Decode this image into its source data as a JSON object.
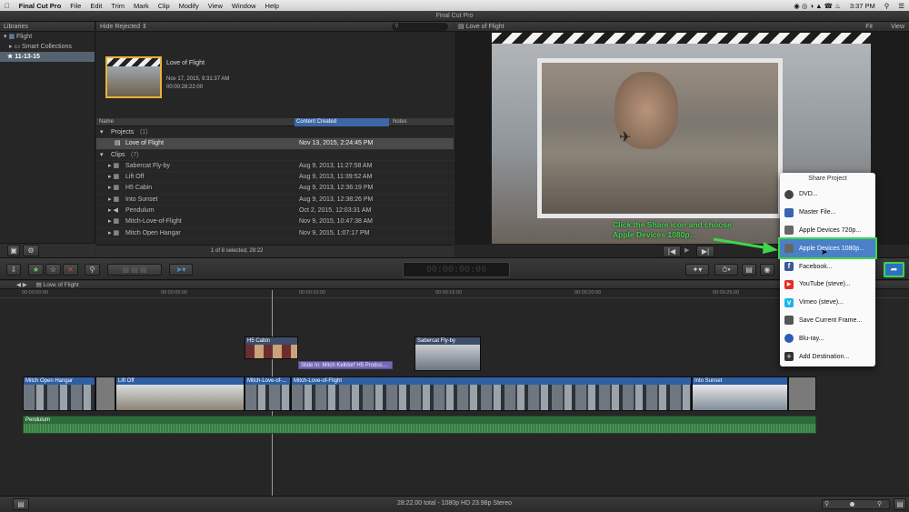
{
  "menubar": {
    "items": [
      "Final Cut Pro",
      "File",
      "Edit",
      "Trim",
      "Mark",
      "Clip",
      "Modify",
      "View",
      "Window",
      "Help"
    ],
    "time": "3:37 PM"
  },
  "window": {
    "title": "Final Cut Pro"
  },
  "libraries": {
    "header": "Libraries",
    "items": [
      "Flight",
      "Smart Collections",
      "11-13-15"
    ]
  },
  "browser": {
    "filter": "Hide Rejected",
    "featured": {
      "title": "Love of Flight",
      "date": "Nov 17, 2015, 9:31:37 AM",
      "duration": "00:00:28:22:00"
    },
    "columns": [
      "Name",
      "Content Created",
      "Notes"
    ],
    "groups": [
      {
        "label": "Projects",
        "count": "(1)",
        "rows": [
          {
            "name": "Love of Flight",
            "date": "Nov 13, 2015, 2:24:45 PM"
          }
        ]
      },
      {
        "label": "Clips",
        "count": "(7)",
        "rows": [
          {
            "name": "Sabercat Fly-by",
            "date": "Aug 9, 2013, 11:27:58 AM"
          },
          {
            "name": "Lift Off",
            "date": "Aug 9, 2013, 11:39:52 AM"
          },
          {
            "name": "H5 Cabin",
            "date": "Aug 9, 2013, 12:36:19 PM"
          },
          {
            "name": "Into Sunset",
            "date": "Aug 9, 2013, 12:38:26 PM"
          },
          {
            "name": "Pendulum",
            "date": "Oct 2, 2015, 12:03:31 AM"
          },
          {
            "name": "Mitch-Love-of-Flight",
            "date": "Nov 9, 2015, 10:47:38 AM"
          },
          {
            "name": "Mitch Open Hangar",
            "date": "Nov 9, 2015, 1:07:17 PM"
          }
        ]
      }
    ],
    "footer": "1 of 8 selected, 28:22"
  },
  "viewer": {
    "title": "Love of Flight",
    "fit": "Fit",
    "view": "View"
  },
  "annotation": {
    "line1": "Click the Share icon and choose",
    "line2": "Apple Devices 1080p..."
  },
  "timecode": "00:00:00:00",
  "timeline": {
    "project": "Love of Flight",
    "ruler": [
      "00:00:00:00",
      "00:00:05:00",
      "00:00:10:00",
      "00:00:15:00",
      "00:00:20:00",
      "00:00:25:00"
    ],
    "clips": {
      "h5": "H5 Cabin",
      "sabercat": "Sabercat Fly-by",
      "title": "Slide In: Mitch Kelldorf H5 Produc...",
      "hangar": "Mitch Open Hangar",
      "lift": "Lift Off",
      "mitch1": "Mitch-Love-of-...",
      "mitch2": "Mitch-Love-of-Flight",
      "sunset": "Into Sunset",
      "pendulum": "Pendulum"
    }
  },
  "share_menu": {
    "header": "Share Project",
    "items": [
      {
        "label": "DVD...",
        "icon": "dvd-icon",
        "color": "#444"
      },
      {
        "label": "Master File...",
        "icon": "film-icon",
        "color": "#3a64b0"
      },
      {
        "label": "Apple Devices 720p...",
        "icon": "devices-icon",
        "color": "#666"
      },
      {
        "label": "Apple Devices 1080p...",
        "icon": "devices-icon",
        "color": "#666"
      },
      {
        "label": "Facebook...",
        "icon": "facebook-icon",
        "color": "#3b5998"
      },
      {
        "label": "YouTube (steve)...",
        "icon": "youtube-icon",
        "color": "#e52d27"
      },
      {
        "label": "Vimeo (steve)...",
        "icon": "vimeo-icon",
        "color": "#1ab7ea"
      },
      {
        "label": "Save Current Frame...",
        "icon": "frame-icon",
        "color": "#555"
      },
      {
        "label": "Blu-ray...",
        "icon": "bluray-icon",
        "color": "#2a5cb8"
      },
      {
        "label": "Add Destination...",
        "icon": "add-icon",
        "color": "#333"
      }
    ]
  },
  "status": {
    "text": "28:22.00 total - 1080p HD 23.98p Stereo"
  }
}
